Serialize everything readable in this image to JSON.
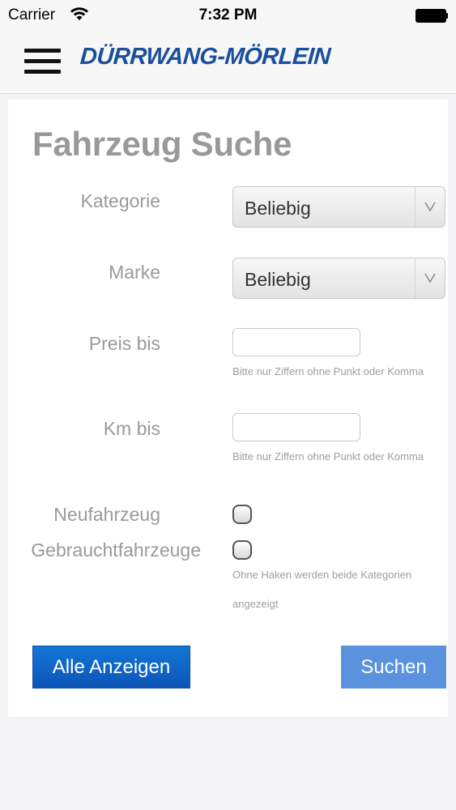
{
  "status_bar": {
    "carrier": "Carrier",
    "time": "7:32 PM"
  },
  "header": {
    "logo_text": "DÜRRWANG-MÖRLEIN",
    "brand_color": "#1b4f9c",
    "menu_icon": "hamburger-menu-icon"
  },
  "form": {
    "title": "Fahrzeug Suche",
    "kategorie_label": "Kategorie",
    "kategorie_value": "Beliebig",
    "marke_label": "Marke",
    "marke_value": "Beliebig",
    "preis_label": "Preis bis",
    "preis_value": "",
    "preis_hint": "Bitte nur Ziffern ohne Punkt oder Komma",
    "km_label": "Km bis",
    "km_value": "",
    "km_hint": "Bitte nur Ziffern ohne Punkt oder Komma",
    "neu_label": "Neufahrzeug",
    "neu_checked": false,
    "gebraucht_label": "Gebrauchtfahrzeuge",
    "gebraucht_checked": false,
    "checkbox_hint": "Ohne Haken werden beide Kategorien angezeigt"
  },
  "buttons": {
    "show_all_label": "Alle Anzeigen",
    "search_label": "Suchen",
    "show_all_color": "#0b66c9",
    "search_color": "#5b92dd"
  }
}
